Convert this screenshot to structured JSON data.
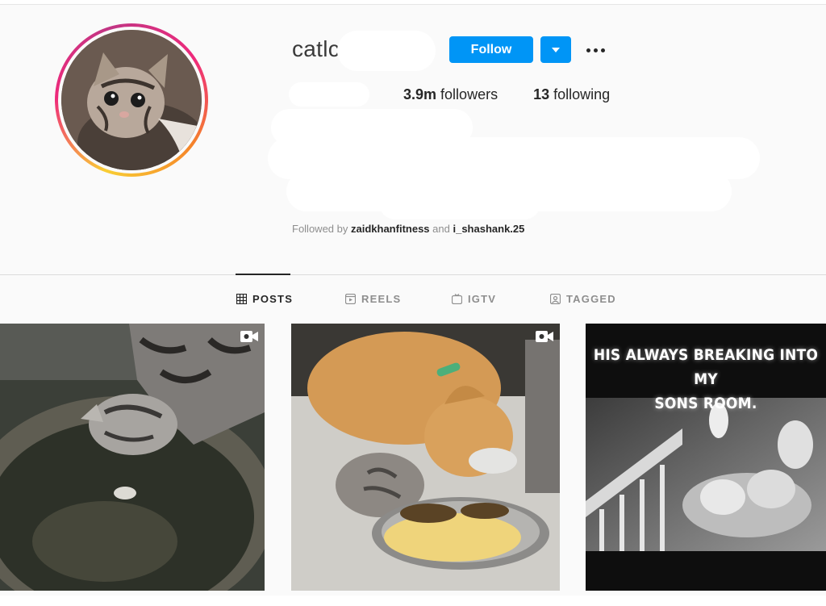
{
  "profile": {
    "username": "catlc",
    "follow_label": "Follow",
    "followers_count": "3.9m",
    "followers_label": "followers",
    "following_count": "13",
    "following_label": "following",
    "followed_by_prefix": "Followed by",
    "followed_by_user_1": "zaidkhanfitness",
    "followed_by_joiner": "and",
    "followed_by_user_2": "i_shashank.25"
  },
  "colors": {
    "accent": "#0095f6",
    "text": "#262626",
    "muted": "#8e8e8e",
    "background": "#fafafa"
  },
  "tabs": [
    {
      "label": "POSTS",
      "icon": "grid-icon",
      "active": true
    },
    {
      "label": "REELS",
      "icon": "reels-icon",
      "active": false
    },
    {
      "label": "IGTV",
      "icon": "igtv-icon",
      "active": false
    },
    {
      "label": "TAGGED",
      "icon": "tagged-icon",
      "active": false
    }
  ],
  "posts": [
    {
      "type": "video",
      "icon": "video-icon"
    },
    {
      "type": "video",
      "icon": "video-icon"
    },
    {
      "type": "image",
      "caption_line_1": "HIS ALWAYS BREAKING INTO MY",
      "caption_line_2": "SONS ROOM."
    }
  ]
}
